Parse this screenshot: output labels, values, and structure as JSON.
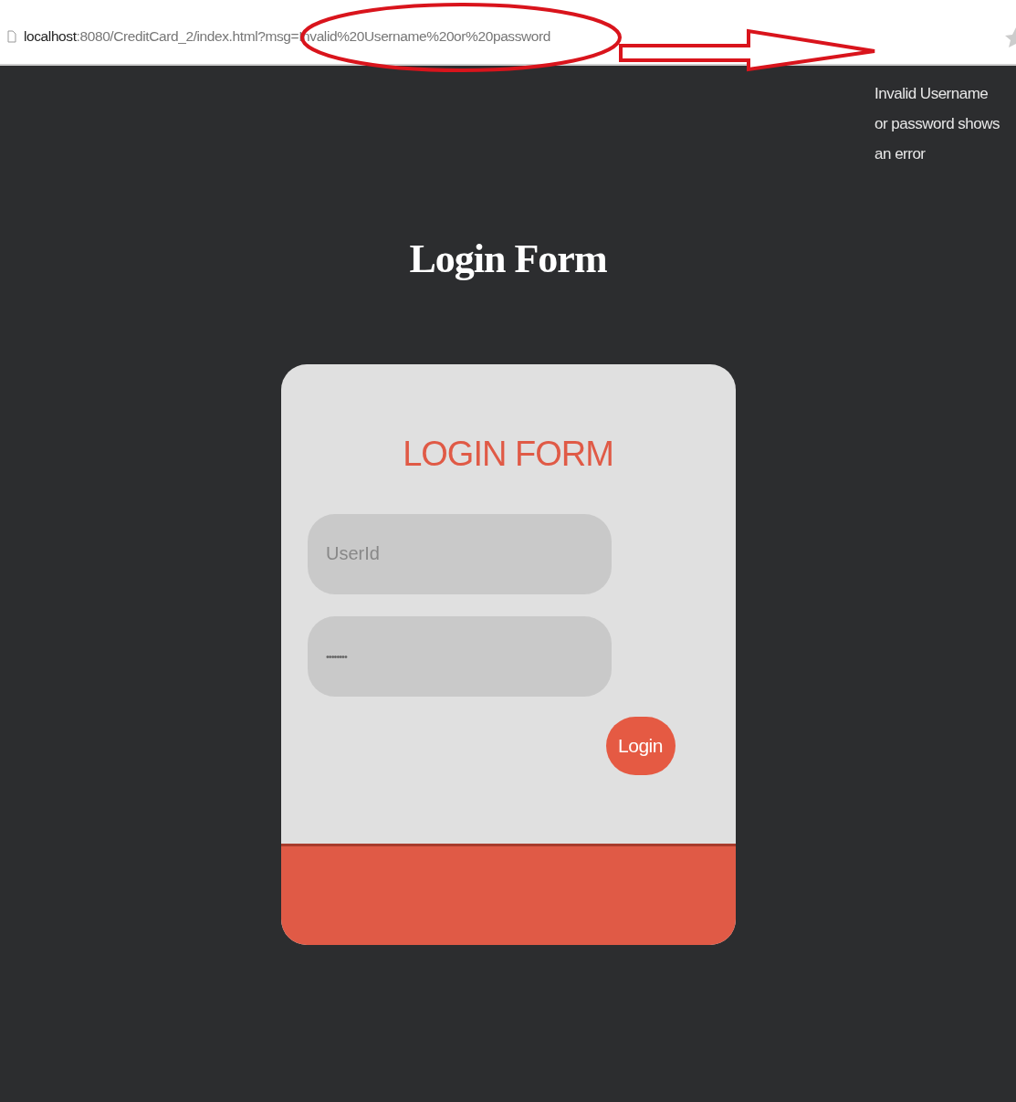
{
  "address_bar": {
    "host": "localhost",
    "path": ":8080/CreditCard_2/index.html?msg=Invalid%20Username%20or%20password"
  },
  "annotation": {
    "text": "Invalid Username or password shows an error"
  },
  "page_title": "Login Form",
  "login_card": {
    "heading": "LOGIN FORM",
    "fields": [
      {
        "kind": "text",
        "placeholder": "UserId"
      },
      {
        "kind": "password",
        "value": "••••••••"
      }
    ],
    "button": "Login"
  }
}
